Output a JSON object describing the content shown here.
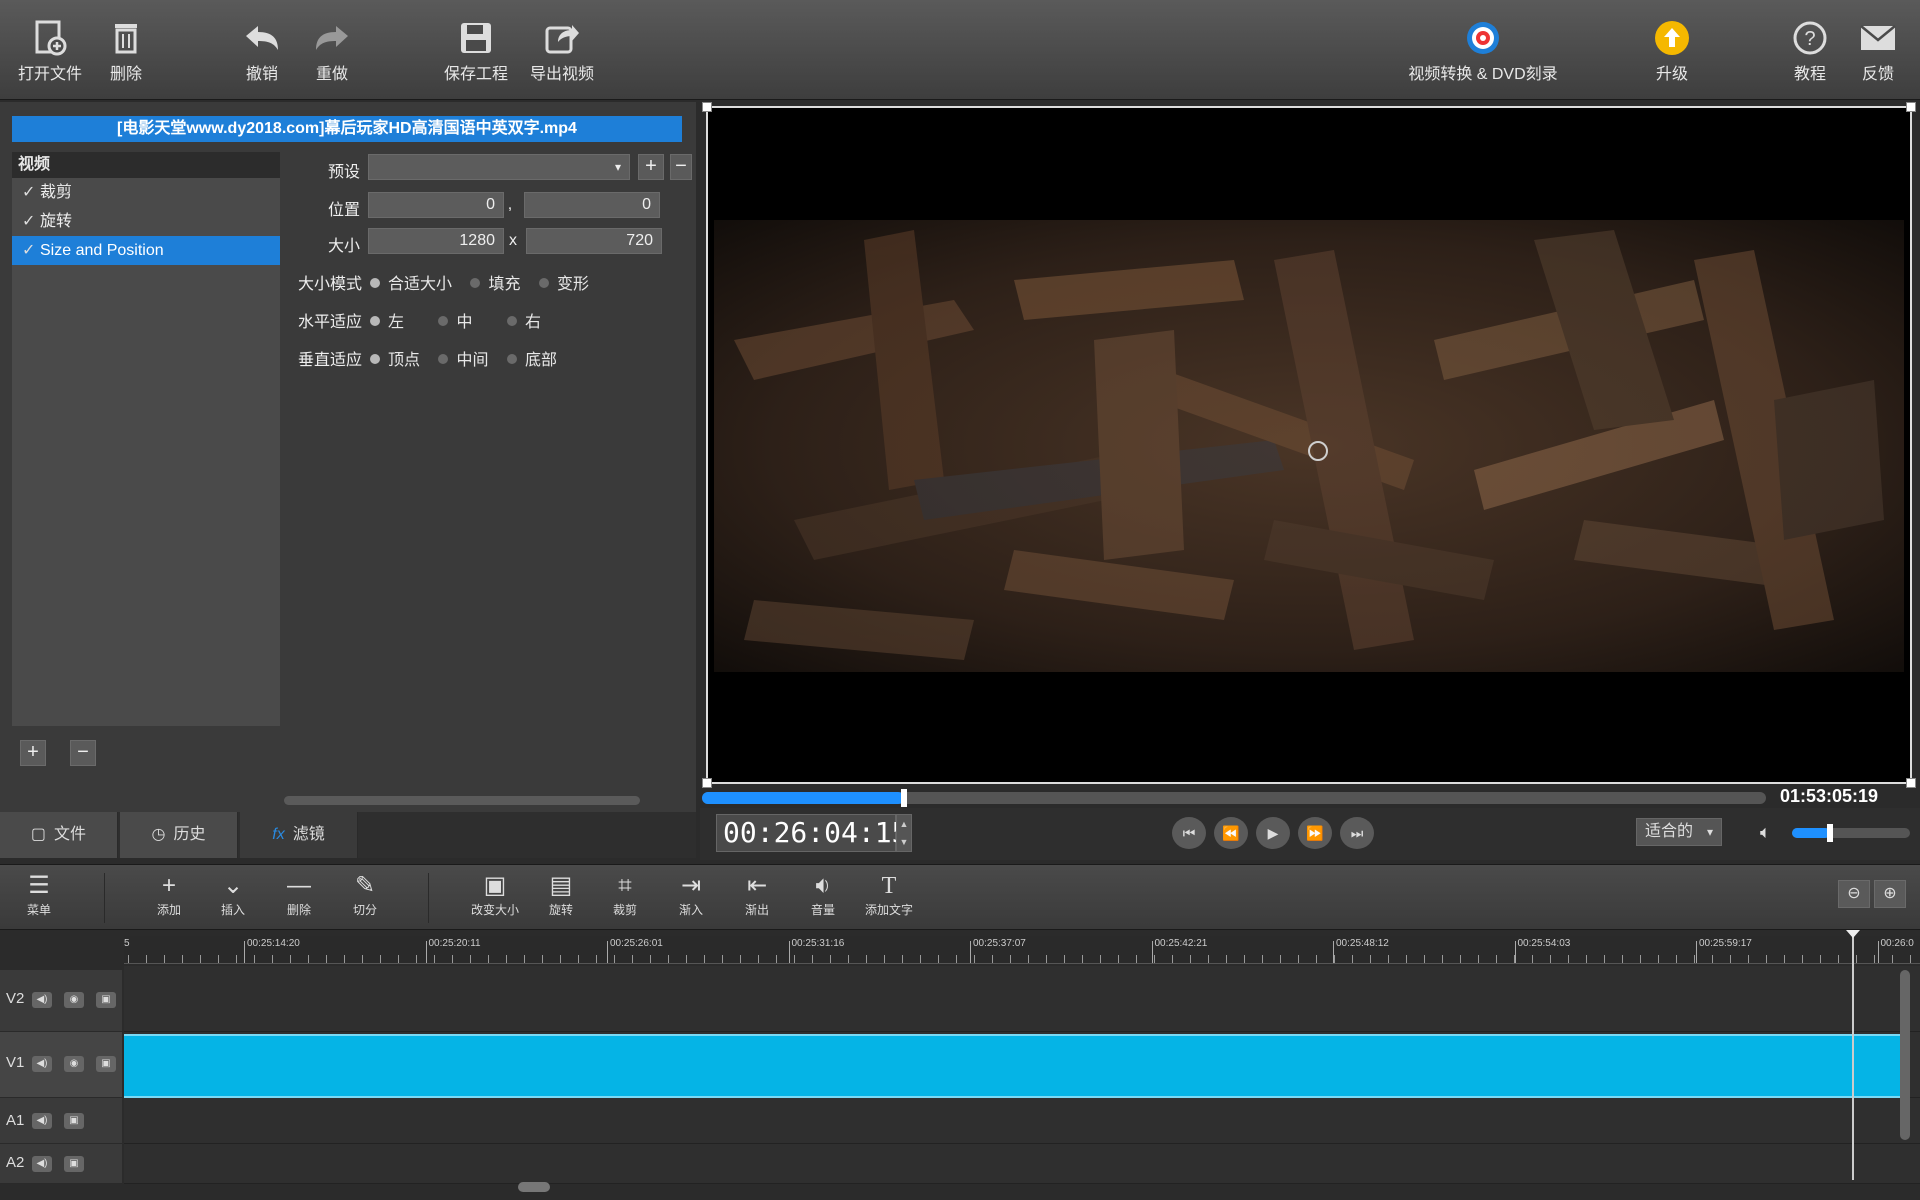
{
  "toolbar": {
    "open_file": "打开文件",
    "delete": "删除",
    "undo": "撤销",
    "redo": "重做",
    "save_project": "保存工程",
    "export_video": "导出视频",
    "convert_dvd": "视频转换 & DVD刻录",
    "upgrade": "升级",
    "tutorial": "教程",
    "feedback": "反馈"
  },
  "file_title": "[电影天堂www.dy2018.com]幕后玩家HD高清国语中英双字.mp4",
  "effects": {
    "header": "视频",
    "items": [
      {
        "check": "✓",
        "label": "裁剪",
        "selected": false
      },
      {
        "check": "✓",
        "label": "旋转",
        "selected": false
      },
      {
        "check": "✓",
        "label": "Size and Position",
        "selected": true
      }
    ],
    "add": "+",
    "remove": "−"
  },
  "properties": {
    "preset_label": "预设",
    "preset_value": "",
    "position_label": "位置",
    "position_x": "0",
    "position_sep": ",",
    "position_y": "0",
    "size_label": "大小",
    "size_w": "1280",
    "size_sep": "x",
    "size_h": "720",
    "size_mode_label": "大小模式",
    "size_mode_options": [
      "合适大小",
      "填充",
      "变形"
    ],
    "h_fit_label": "水平适应",
    "h_fit_options": [
      "左",
      "中",
      "右"
    ],
    "v_fit_label": "垂直适应",
    "v_fit_options": [
      "顶点",
      "中间",
      "底部"
    ]
  },
  "bottom_tabs": {
    "file": "文件",
    "history": "历史",
    "filters": "滤镜"
  },
  "player": {
    "timecode": "00:26:04:15",
    "duration": "01:53:05:19",
    "progress": 0.19,
    "fit_label": "适合的",
    "volume": 0.32
  },
  "edit_toolbar": {
    "menu": "菜单",
    "add": "添加",
    "insert": "插入",
    "delete": "删除",
    "split": "切分",
    "resize": "改变大小",
    "rotate": "旋转",
    "crop": "裁剪",
    "fade_in": "渐入",
    "fade_out": "渐出",
    "volume": "音量",
    "add_text": "添加文字"
  },
  "ruler_labels": [
    "00:25:14:20",
    "00:25:20:11",
    "00:25:26:01",
    "00:25:31:16",
    "00:25:37:07",
    "00:25:42:21",
    "00:25:48:12",
    "00:25:54:03",
    "00:25:59:17",
    "00:26:0"
  ],
  "ruler_start": "5",
  "tracks": {
    "v2": "V2",
    "v1": "V1",
    "a1": "A1",
    "a2": "A2"
  },
  "colors": {
    "accent": "#1e7fd8",
    "clip": "#05b4e6"
  }
}
